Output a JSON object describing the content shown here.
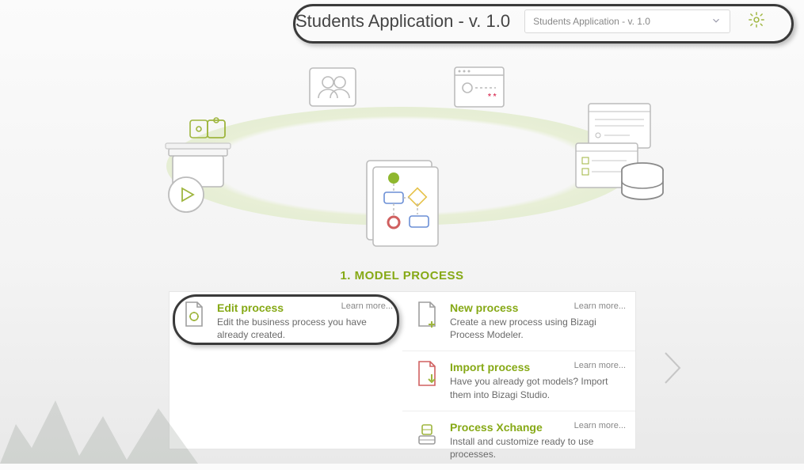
{
  "header": {
    "title": "Students Application - v. 1.0",
    "select_value": "Students Application - v. 1.0"
  },
  "section_title": "1. MODEL PROCESS",
  "cards": {
    "edit": {
      "title": "Edit process",
      "desc": "Edit the business process you have already created.",
      "learn": "Learn more..."
    },
    "new": {
      "title": "New process",
      "desc": "Create a new process using Bizagi Process Modeler.",
      "learn": "Learn more..."
    },
    "import": {
      "title": "Import process",
      "desc": "Have you already got models? Import them into Bizagi Studio.",
      "learn": "Learn more..."
    },
    "xchange": {
      "title": "Process Xchange",
      "desc": "Install and customize ready to use processes.",
      "learn": "Learn more..."
    }
  }
}
